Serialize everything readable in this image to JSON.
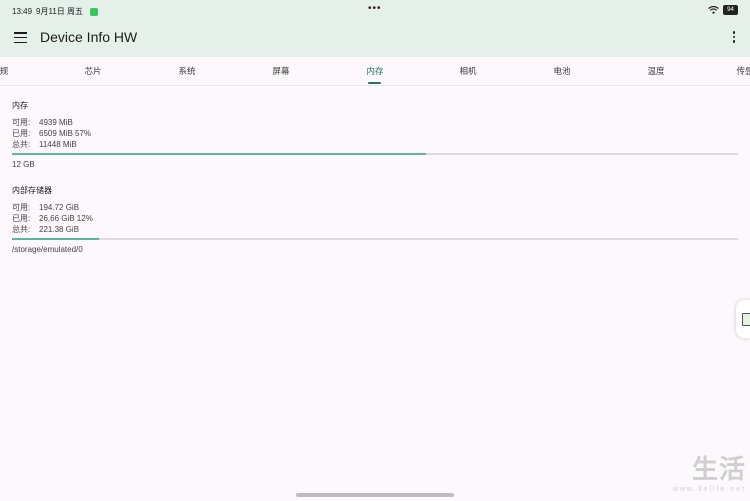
{
  "status_bar": {
    "time": "13:49",
    "date": "9月11日 周五",
    "dots": "•••",
    "battery": "94"
  },
  "app_bar": {
    "title": "Device Info HW"
  },
  "tabs": [
    "规",
    "芯片",
    "系统",
    "屏幕",
    "内存",
    "相机",
    "电池",
    "温度",
    "传感"
  ],
  "active_tab": "内存",
  "memory": {
    "title": "内存",
    "available_label": "可用:",
    "available_value": "4939 MiB",
    "used_label": "已用:",
    "used_value": "6509 MiB 57%",
    "total_label": "总共:",
    "total_value": "11448 MiB",
    "usage_fraction": 0.57,
    "size_label": "12 GB"
  },
  "storage": {
    "title": "内部存储器",
    "available_label": "可用:",
    "available_value": "194.72 GiB",
    "used_label": "已用:",
    "used_value": "26.66 GiB 12%",
    "total_label": "总共:",
    "total_value": "221.38 GiB",
    "usage_fraction": 0.12,
    "path": "/storage/emulated/0"
  },
  "watermark": {
    "logo": "生活",
    "url": "www.3elife.net"
  },
  "colors": {
    "accent": "#1f7a5a",
    "bar_fill": "#5bb99a",
    "app_bar_bg": "#e6f0eb"
  }
}
